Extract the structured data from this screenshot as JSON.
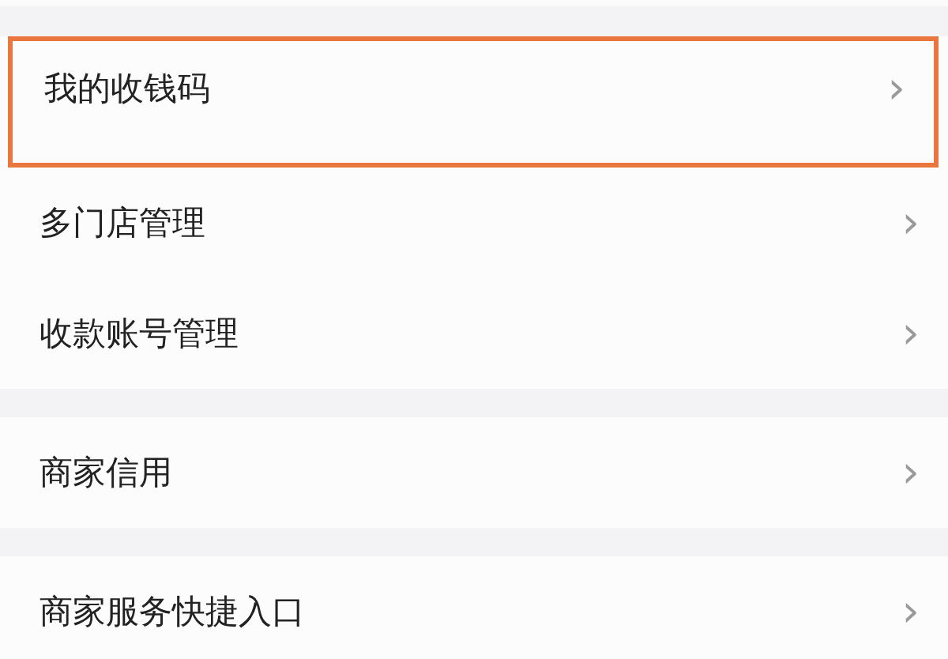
{
  "groups": [
    {
      "items": [
        {
          "label": "我的收钱码",
          "chevron": "›",
          "highlighted": true
        },
        {
          "label": "多门店管理",
          "chevron": "›",
          "highlighted": false
        },
        {
          "label": "收款账号管理",
          "chevron": "›",
          "highlighted": false
        }
      ]
    },
    {
      "items": [
        {
          "label": "商家信用",
          "chevron": "›",
          "highlighted": false
        }
      ]
    },
    {
      "items": [
        {
          "label": "商家服务快捷入口",
          "chevron": "›",
          "highlighted": false
        }
      ]
    }
  ]
}
